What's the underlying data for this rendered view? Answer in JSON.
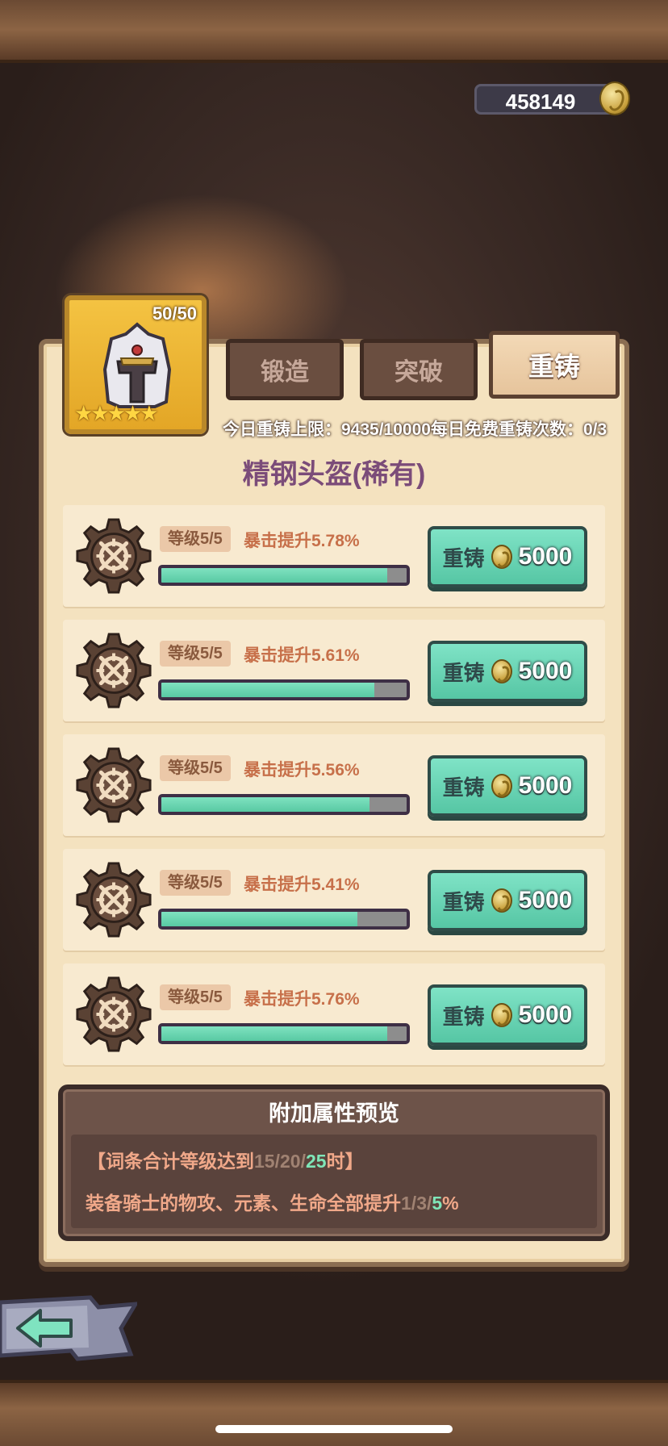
{
  "currency": {
    "amount": "458149",
    "icon": "gold-coin-icon"
  },
  "item": {
    "count": "50/50",
    "stars": "★★★★★",
    "icon": "steel-helmet-icon",
    "title": "精钢头盔(稀有)"
  },
  "tabs": [
    {
      "label": "锻造",
      "active": false
    },
    {
      "label": "突破",
      "active": false
    },
    {
      "label": "重铸",
      "active": true
    }
  ],
  "limit_text": "今日重铸上限：9435/10000每日免费重铸次数：0/3",
  "attributes": [
    {
      "level": "等级5/5",
      "stat": "暴击提升5.78%",
      "progress": 0.92,
      "button_label": "重铸",
      "cost": "5000"
    },
    {
      "level": "等级5/5",
      "stat": "暴击提升5.61%",
      "progress": 0.87,
      "button_label": "重铸",
      "cost": "5000"
    },
    {
      "level": "等级5/5",
      "stat": "暴击提升5.56%",
      "progress": 0.85,
      "button_label": "重铸",
      "cost": "5000"
    },
    {
      "level": "等级5/5",
      "stat": "暴击提升5.41%",
      "progress": 0.8,
      "button_label": "重铸",
      "cost": "5000"
    },
    {
      "level": "等级5/5",
      "stat": "暴击提升5.76%",
      "progress": 0.92,
      "button_label": "重铸",
      "cost": "5000"
    }
  ],
  "preview": {
    "title": "附加属性预览",
    "line1": {
      "prefix": "【词条合计等级达到",
      "v1": "15",
      "s1": "/",
      "v2": "20",
      "s2": "/",
      "v3": "25",
      "suffix": "时】"
    },
    "line2": {
      "prefix": "装备骑士的物攻、元素、生命全部提升",
      "v1": "1",
      "s1": "/",
      "v2": "3",
      "s2": "/",
      "v3": "5",
      "suffix": "%"
    }
  },
  "colors": {
    "accent_green": "#58c9a3",
    "title_purple": "#7b4c79",
    "stat_orange": "#c7704a"
  }
}
